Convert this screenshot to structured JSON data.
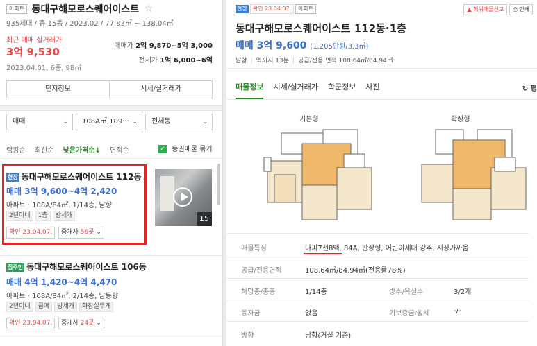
{
  "left": {
    "header": {
      "badge": "아파트",
      "title": "동대구해모로스퀘어이스트",
      "star": "☆",
      "subtitle": "935세대 / 총 15동 / 2023.02 / 77.83㎡ ~ 138.04㎡"
    },
    "recent": {
      "label": "최근 매매 실거래가",
      "price": "3억 9,530",
      "date": "2023.04.01, 6층, 98㎡",
      "sale_label": "매매가",
      "sale_value": "2억 9,870~5억 3,000",
      "jeonse_label": "전세가",
      "jeonse_value": "1억 6,000~6억"
    },
    "buttons": {
      "complex_info": "단지정보",
      "price_info": "시세/실거래가"
    },
    "filters": {
      "deal_type": "매매",
      "area": "108A㎡,109···",
      "dong": "전체동"
    },
    "sorts": {
      "ranking": "랭킹순",
      "latest": "최신순",
      "low_price": "낮은가격순↓",
      "area": "면적순",
      "group_label": "동일매물 묶기",
      "group_check": "✓"
    },
    "listings": [
      {
        "tag": "현장",
        "title": "동대구해모로스퀘어이스트 112동",
        "price": "매매 3억 9,600~4억 2,420",
        "info": "아파트 · 108A/84㎡, 1/14층, 남향",
        "chips": [
          "2년이내",
          "1층",
          "방세개"
        ],
        "confirm": "확인 23.04.07.",
        "agent_prefix": "중개사",
        "agent_count": "56곳",
        "photo_count": "15"
      },
      {
        "tag": "집주인",
        "title": "동대구해모로스퀘어이스트 106동",
        "price": "매매 4억 1,420~4억 4,470",
        "info": "아파트 · 108A/84㎡, 2/14층, 남동향",
        "chips": [
          "2년이내",
          "급매",
          "방세개",
          "화장실두개"
        ],
        "confirm": "확인 23.04.07.",
        "agent_prefix": "중개사",
        "agent_count": "24곳"
      }
    ]
  },
  "right": {
    "badges": {
      "current": "현장",
      "confirm": "확인 23.04.07.",
      "type": "아파트"
    },
    "actions": {
      "report": "허위매물신고",
      "print": "인쇄"
    },
    "title": "동대구해모로스퀘어이스트 112동·1층",
    "price": "매매 3억 9,600",
    "price_per": "(1,205만원/3.3㎡)",
    "info": [
      "남향",
      "역까지 13분",
      "공급/전용 면적 108.64㎡/84.94㎡"
    ],
    "tabs": [
      "매물정보",
      "시세/실거래가",
      "학군정보",
      "사진"
    ],
    "tab_extra": "평",
    "plans": {
      "basic": "기본형",
      "extended": "확장형"
    },
    "table": {
      "feature_label": "매물특징",
      "feature_value": "마피7천8백, 84A, 판상형, 어린이세대 강추, 시장가까움",
      "area_label": "공급/전용면적",
      "area_value": "108.64㎡/84.94㎡(전용률78%)",
      "floor_label": "해당층/총층",
      "floor_value": "1/14층",
      "rooms_label": "방수/욕실수",
      "rooms_value": "3/2개",
      "loan_label": "융자금",
      "loan_value": "없음",
      "deposit_label": "기보증금/월세",
      "deposit_value": "-/-",
      "direction_label": "방향",
      "direction_value": "남향(거실 기준)"
    }
  }
}
